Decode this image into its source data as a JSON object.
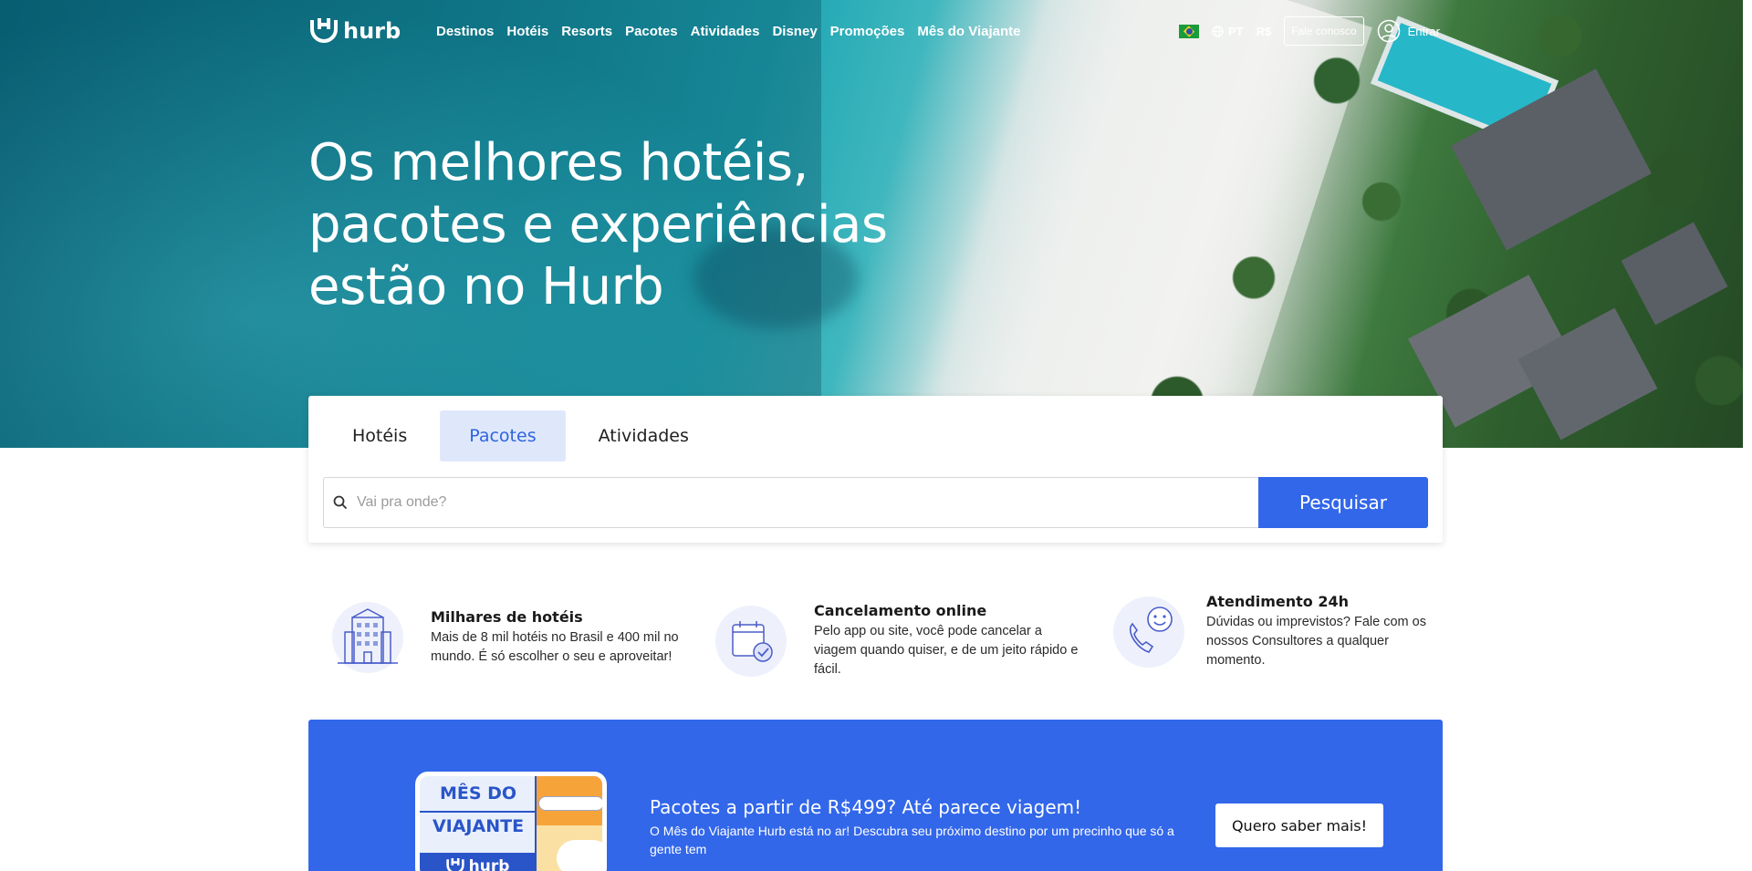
{
  "header": {
    "logo_text": "hurb",
    "nav": [
      "Destinos",
      "Hotéis",
      "Resorts",
      "Pacotes",
      "Atividades",
      "Disney",
      "Promoções",
      "Mês do Viajante"
    ],
    "language": "PT",
    "currency": "R$",
    "contact_label": "Fale conosco",
    "login_label": "Entrar"
  },
  "hero": {
    "title_lines": [
      "Os melhores hotéis,",
      "pacotes e experiências",
      "estão no Hurb"
    ]
  },
  "search": {
    "tabs": [
      "Hotéis",
      "Pacotes",
      "Atividades"
    ],
    "active_tab": "Pacotes",
    "placeholder": "Vai pra onde?",
    "value": "",
    "button_label": "Pesquisar"
  },
  "features": [
    {
      "title": "Milhares de hotéis",
      "text": "Mais de 8 mil hotéis no Brasil e 400 mil no mundo. É só escolher o seu e aproveitar!",
      "icon": "hotel-building-icon"
    },
    {
      "title": "Cancelamento online",
      "text": "Pelo app ou site, você pode cancelar a viagem quando quiser, e de um jeito rápido e fácil.",
      "icon": "calendar-check-icon"
    },
    {
      "title": "Atendimento 24h",
      "text": "Dúvidas ou imprevistos? Fale com os nossos Consultores a qualquer momento.",
      "icon": "phone-chat-icon"
    }
  ],
  "promo": {
    "badge_line1": "MÊS DO",
    "badge_line2": "VIAJANTE",
    "badge_logo": "hurb",
    "title": "Pacotes a partir de R$499? Até parece viagem!",
    "text": "O Mês do Viajante Hurb está no ar! Descubra seu próximo destino por um precinho que só a gente tem",
    "button_label": "Quero saber mais!"
  },
  "colors": {
    "primary": "#3267ea",
    "tab_active_bg": "#dfe8fb",
    "tab_active_text": "#2f63e0"
  }
}
